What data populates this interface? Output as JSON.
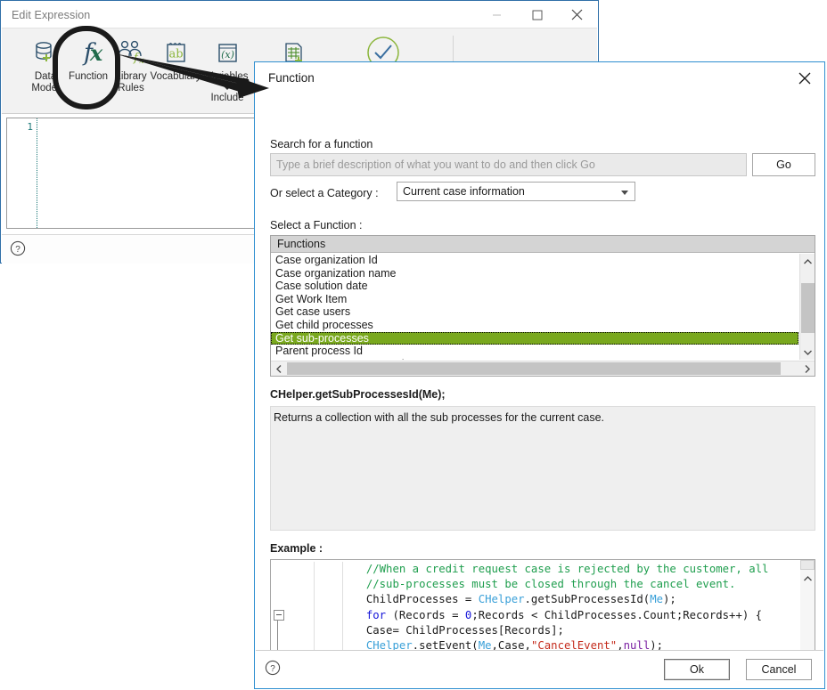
{
  "edit_expression_window": {
    "title": "Edit Expression",
    "window_buttons": [
      {
        "name": "minimize",
        "glyph": "minimize-icon"
      },
      {
        "name": "maximize",
        "glyph": "maximize-icon"
      },
      {
        "name": "close",
        "glyph": "close-icon"
      }
    ],
    "toolbar": {
      "items": [
        {
          "label_line1": "Data",
          "label_line2": "Model",
          "icon": "database-add-icon"
        },
        {
          "label_line1": "Function",
          "label_line2": "",
          "icon": "fx-icon"
        },
        {
          "label_line1": "Library",
          "label_line2": "Rules",
          "icon": "library-rules-icon"
        },
        {
          "label_line1": "Vocabulary",
          "label_line2": "",
          "icon": "ab-vocabulary-icon"
        },
        {
          "label_line1": "Variables",
          "label_line2": "",
          "icon": "variables-x-icon"
        },
        {
          "label_line1": "Include",
          "label_line2": "",
          "icon": "table-add-icon"
        }
      ],
      "validate_icon": "check-circle-icon",
      "clipboard_icons": [
        {
          "name": "save-icon"
        },
        {
          "name": "cut-icon"
        },
        {
          "name": "copy-icon"
        },
        {
          "name": "paste-icon"
        }
      ]
    },
    "editor": {
      "line_numbers": [
        "1"
      ],
      "content": ""
    },
    "help_icon": "help-circle-icon"
  },
  "function_dialog": {
    "title": "Function",
    "close_icon": "close-icon",
    "search": {
      "label": "Search for a function",
      "value": "",
      "placeholder": "Type a brief description of what you want to do and then click Go",
      "go_label": "Go"
    },
    "category": {
      "label": "Or select a Category :",
      "selected": "Current case information",
      "dropdown_icon": "chevron-down-icon"
    },
    "function_list": {
      "label": "Select a Function :",
      "header": "Functions",
      "selected_index": 6,
      "items": [
        "Case organization Id",
        "Case organization name",
        "Case solution date",
        "Get Work Item",
        "Get case users",
        "Get child processes",
        "Get sub-processes",
        "Parent process Id",
        "Parent process case number"
      ],
      "scroll_up_icon": "chevron-up-icon",
      "scroll_down_icon": "chevron-down-icon",
      "scroll_left_icon": "chevron-left-icon",
      "scroll_right_icon": "chevron-right-icon"
    },
    "signature": "CHelper.getSubProcessesId(Me);",
    "description": "Returns a collection with all the sub processes for the current case.",
    "example": {
      "label": "Example :",
      "lines": [
        [
          {
            "t": "            ",
            "c": "c-pln"
          },
          {
            "t": "//When a credit request case is rejected by the customer, all",
            "c": "c-cmt"
          }
        ],
        [
          {
            "t": "            ",
            "c": "c-pln"
          },
          {
            "t": "//sub-processes must be closed through the cancel event.",
            "c": "c-cmt"
          }
        ],
        [
          {
            "t": "            ChildProcesses = ",
            "c": "c-pln"
          },
          {
            "t": "CHelper",
            "c": "c-type"
          },
          {
            "t": ".getSubProcessesId(",
            "c": "c-pln"
          },
          {
            "t": "Me",
            "c": "c-type"
          },
          {
            "t": ");",
            "c": "c-pln"
          }
        ],
        [
          {
            "t": "            ",
            "c": "c-pln"
          },
          {
            "t": "for",
            "c": "c-kw"
          },
          {
            "t": " (Records = ",
            "c": "c-pln"
          },
          {
            "t": "0",
            "c": "c-num"
          },
          {
            "t": ";Records < ChildProcesses.Count;Records++) {",
            "c": "c-pln"
          }
        ],
        [
          {
            "t": "            Case= ChildProcesses[Records];",
            "c": "c-pln"
          }
        ],
        [
          {
            "t": "            ",
            "c": "c-pln"
          },
          {
            "t": "CHelper",
            "c": "c-type"
          },
          {
            "t": ".setEvent(",
            "c": "c-pln"
          },
          {
            "t": "Me",
            "c": "c-type"
          },
          {
            "t": ",Case,",
            "c": "c-pln"
          },
          {
            "t": "\"CancelEvent\"",
            "c": "c-str"
          },
          {
            "t": ",",
            "c": "c-pln"
          },
          {
            "t": "null",
            "c": "c-pur"
          },
          {
            "t": ");",
            "c": "c-pln"
          }
        ]
      ],
      "fold_marker": "collapse-icon",
      "scroll_up_icon": "chevron-up-icon",
      "scroll_down_icon": "chevron-down-icon",
      "scroll_left_icon": "chevron-left-icon",
      "scroll_right_icon": "chevron-right-icon"
    },
    "footer": {
      "help_icon": "help-circle-icon",
      "ok_label": "Ok",
      "cancel_label": "Cancel"
    }
  },
  "annotations": {
    "highlight_shape": "rounded-ellipse-around-function-button",
    "arrow": "arrow-from-function-button-to-function-dialog"
  },
  "colors": {
    "selection_green": "#79a81e",
    "dialog_border_blue": "#2f8fd0",
    "window_border_blue": "#2f6fa8",
    "icon_green": "#8cb63c",
    "icon_blue": "#2c4f6b",
    "toolbar_bg": "#f2f2f2",
    "comment_green": "#1f9e4e",
    "keyword_blue": "#1414d8",
    "type_cyan": "#3aa0d8",
    "string_red": "#c42b1c",
    "purple_null": "#7a1fa2"
  }
}
